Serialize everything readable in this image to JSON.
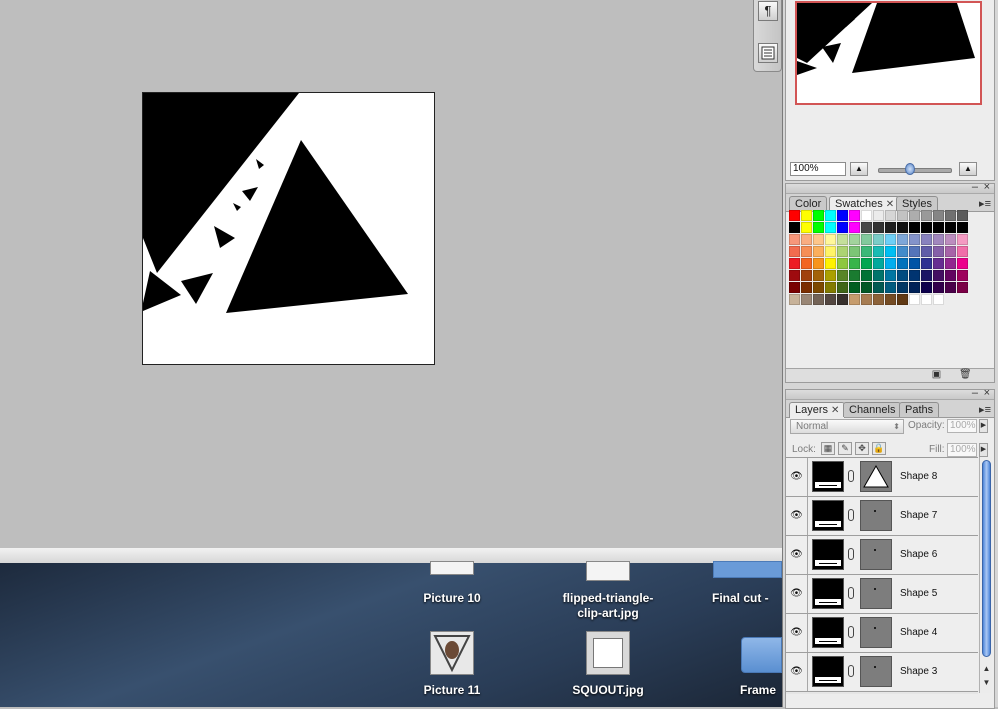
{
  "navigator": {
    "zoom_value": "100%",
    "zoom_slider_fraction": 0.45
  },
  "swatches_panel": {
    "tabs": [
      "Color",
      "Swatches",
      "Styles"
    ],
    "active_tab": "Swatches",
    "footer_icons": [
      "new-swatch-icon",
      "trash-icon"
    ],
    "colors": [
      [
        "#ff0000",
        "#ffff00",
        "#00ff00",
        "#00ffff",
        "#0000ff",
        "#ff00ff",
        "#ffffff",
        "#ebebeb",
        "#d6d6d6",
        "#c2c2c2",
        "#adadad",
        "#999999",
        "#858585",
        "#707070",
        "#5c5c5c"
      ],
      [
        "#000000",
        "#ffff00",
        "#00ff00",
        "#00ffff",
        "#0000ff",
        "#ff00ff",
        "#474747",
        "#333333",
        "#1f1f1f",
        "#101010",
        "#000000",
        "#000000",
        "#000000",
        "#000000",
        "#000000"
      ],
      [
        "#f7977a",
        "#f9ad81",
        "#fdc68a",
        "#fff79a",
        "#c4df9b",
        "#a2d39c",
        "#82ca9d",
        "#7bcdc8",
        "#6ecff6",
        "#7ea7d8",
        "#8493ca",
        "#8882be",
        "#a187be",
        "#bc8dbf",
        "#f49ac2"
      ],
      [
        "#f26c4f",
        "#f68e55",
        "#fbaf5c",
        "#fff467",
        "#acd372",
        "#7cc576",
        "#3bb878",
        "#1abbb4",
        "#00bff3",
        "#438cca",
        "#5574b9",
        "#605ca8",
        "#855fa8",
        "#a763a8",
        "#f06ea9"
      ],
      [
        "#ed1c24",
        "#f26522",
        "#f7941d",
        "#fff200",
        "#8dc73f",
        "#39b54a",
        "#00a651",
        "#00a99d",
        "#00aeef",
        "#0072bc",
        "#0054a6",
        "#2e3192",
        "#662d91",
        "#92278f",
        "#ec008c"
      ],
      [
        "#9e0b0f",
        "#a0410d",
        "#a36209",
        "#aba000",
        "#598527",
        "#1a7b30",
        "#007236",
        "#00746b",
        "#0076a3",
        "#004b80",
        "#003471",
        "#1b1464",
        "#440e62",
        "#630460",
        "#9e005d"
      ],
      [
        "#790000",
        "#7b2e00",
        "#7d4900",
        "#827b00",
        "#406618",
        "#005e20",
        "#005826",
        "#005952",
        "#005b7f",
        "#003663",
        "#002157",
        "#0d004c",
        "#32004b",
        "#4b0049",
        "#7b0046"
      ],
      [
        "#c7b299",
        "#998675",
        "#736357",
        "#534741",
        "#37302d",
        "#c69c6d",
        "#a67c52",
        "#8c6239",
        "#754c24",
        "#603913",
        "#ffffff",
        "#ffffff",
        "#ffffff"
      ]
    ]
  },
  "layers_panel": {
    "tabs": [
      "Layers",
      "Channels",
      "Paths"
    ],
    "active_tab": "Layers",
    "blend_mode": "Normal",
    "opacity_label": "Opacity:",
    "opacity_value": "100%",
    "lock_label": "Lock:",
    "fill_label": "Fill:",
    "fill_value": "100%",
    "layers": [
      {
        "name": "Shape 8",
        "mask": "triangle",
        "visible": true
      },
      {
        "name": "Shape 7",
        "mask": "dot",
        "visible": true
      },
      {
        "name": "Shape 6",
        "mask": "dot",
        "visible": true
      },
      {
        "name": "Shape 5",
        "mask": "dot",
        "visible": true
      },
      {
        "name": "Shape 4",
        "mask": "dot",
        "visible": true
      },
      {
        "name": "Shape 3",
        "mask": "dot",
        "visible": true
      }
    ]
  },
  "desktop": {
    "items": [
      {
        "label": "Picture 10"
      },
      {
        "label_line1": "flipped-triangle-",
        "label_line2": "clip-art.jpg"
      },
      {
        "label": "Final cut -"
      },
      {
        "label": "Picture 11"
      },
      {
        "label": "SQUOUT.jpg"
      },
      {
        "label": "Frame"
      }
    ]
  },
  "dock": {
    "buttons": [
      "paragraph-icon",
      "layer-comps-icon"
    ],
    "paragraph_glyph": "¶"
  }
}
